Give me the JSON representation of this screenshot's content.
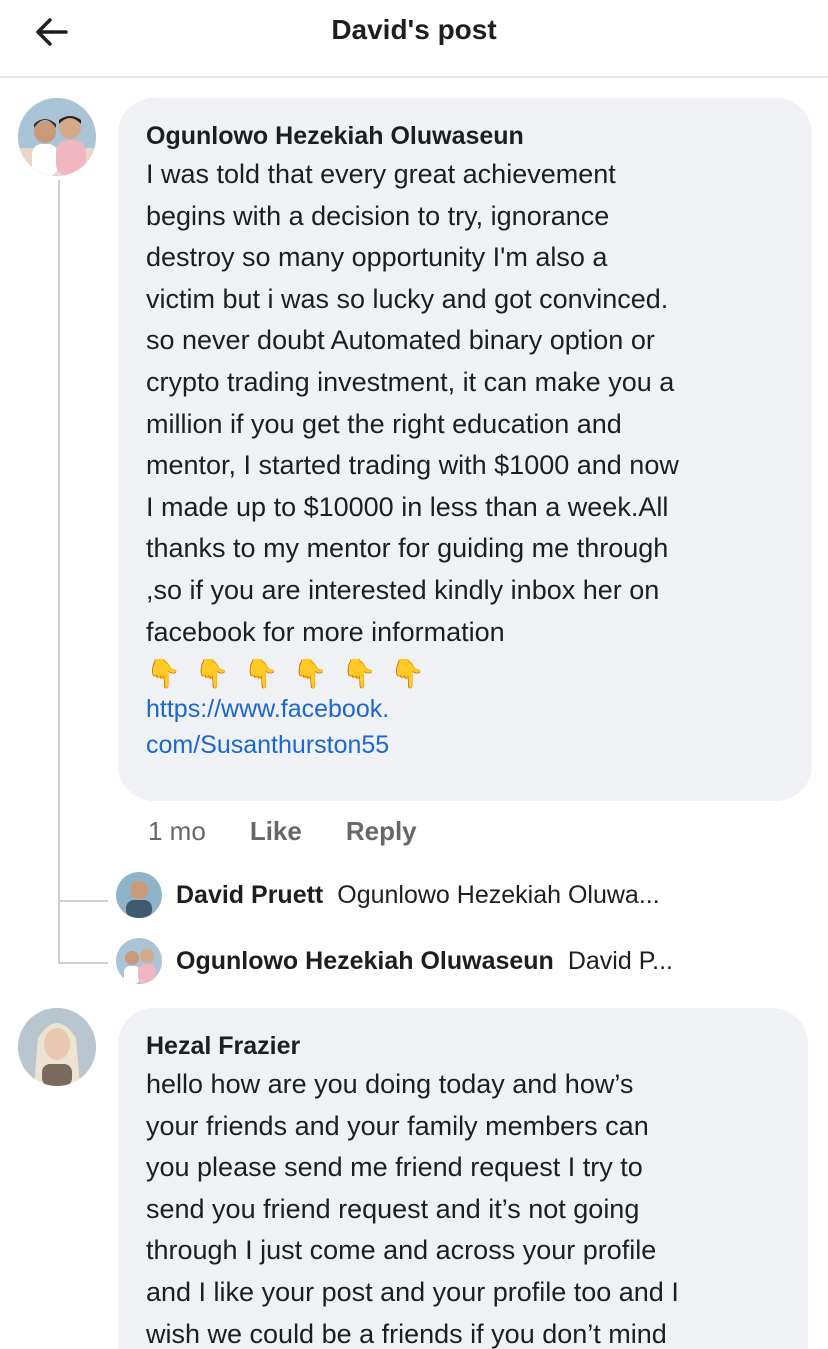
{
  "header": {
    "title": "David's post",
    "back_icon": "arrow-left-icon"
  },
  "comments": [
    {
      "author": "Ogunlowo Hezekiah Oluwaseun",
      "text": "I was told that every great achievement\nbegins with a decision to try, ignorance\ndestroy so many opportunity I'm also a\nvictim but i was so lucky and got convinced.\nso never doubt Automated binary option or\ncrypto trading investment, it can make you a\nmillion if you get the right education and\nmentor, I started trading with $1000 and now\nI made up to $10000 in less than a week.All\nthanks to my mentor for guiding me through\n,so if you are interested kindly inbox her on\nfacebook for more information",
      "emoji": [
        "👇",
        "👇",
        "👇",
        "👇",
        "👇",
        "👇"
      ],
      "link_line1": "https://www.facebook.",
      "link_line2": "com/Susanthurston55",
      "time": "1 mo",
      "like_label": "Like",
      "reply_label": "Reply",
      "replies": [
        {
          "author": "David Pruett",
          "preview": "Ogunlowo Hezekiah Oluwa..."
        },
        {
          "author": "Ogunlowo Hezekiah Oluwaseun",
          "preview": "David P..."
        }
      ]
    },
    {
      "author": "Hezal Frazier",
      "text": "hello how are you doing today and how’s\nyour friends and your family members can\nyou please send me friend request I try to\nsend you friend request and it’s not going\nthrough I just come and across your profile\nand I like your post and your profile too and I\nwish we could be a friends if you don’t mind"
    }
  ],
  "colors": {
    "bubble": "#eff1f5",
    "link": "#1a66d2",
    "muted": "#65676b"
  }
}
